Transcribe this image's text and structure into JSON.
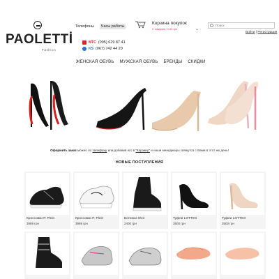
{
  "brand": {
    "name": "PAOLETTİ",
    "tagline": "Fashion"
  },
  "top_nav": [
    {
      "label": "Телефоны",
      "active": false
    },
    {
      "label": "Часы работы",
      "active": true
    }
  ],
  "phones": [
    {
      "operator": "МТС",
      "number": "(095) 629 87 41",
      "color": "#e2202a"
    },
    {
      "operator": "KS",
      "number": "(067) 742 44 20",
      "color": "#2a6fd6"
    }
  ],
  "cart": {
    "title": "Корзина покупок",
    "summary": "0 товаров / 0.00 грн"
  },
  "search": {
    "placeholder": "Поиск"
  },
  "auth": {
    "login": "Войти",
    "register": "Регистрация",
    "separator": " | "
  },
  "main_nav": [
    "ЖЕНСКАЯ ОБУВЬ",
    "МУЖСКАЯ ОБУВЬ",
    "БРЕНДЫ",
    "СКИДКИ"
  ],
  "order_line": {
    "bold": "Оформить заказ",
    "part1": " можно по ",
    "link1": "телефону",
    "part2": " или добавив его в ",
    "link2": "\"Корзину\"",
    "part3": " и наши менеджеры свяжутся с Вами в этот же день!"
  },
  "section_title": "НОВЫЕ ПОСТУПЛЕНИЯ",
  "products": [
    {
      "name": "Кроссовки P. Plein",
      "price": "3999 грн"
    },
    {
      "name": "Кроссовки P. Plein",
      "price": "3999 грн"
    },
    {
      "name": "Ботинки Shol",
      "price": "2400 грн"
    },
    {
      "name": "Туфли LOTTINI",
      "price": "3500 грн"
    },
    {
      "name": "Туфли LOTTINI",
      "price": "3500 грн"
    },
    {
      "name": "",
      "price": ""
    },
    {
      "name": "",
      "price": ""
    },
    {
      "name": "",
      "price": ""
    },
    {
      "name": "",
      "price": ""
    },
    {
      "name": "",
      "price": ""
    }
  ],
  "colors": {
    "accent_red": "#e0304a",
    "sole_red": "#d61f1f",
    "nude": "#e8c9ac",
    "black": "#111111"
  }
}
